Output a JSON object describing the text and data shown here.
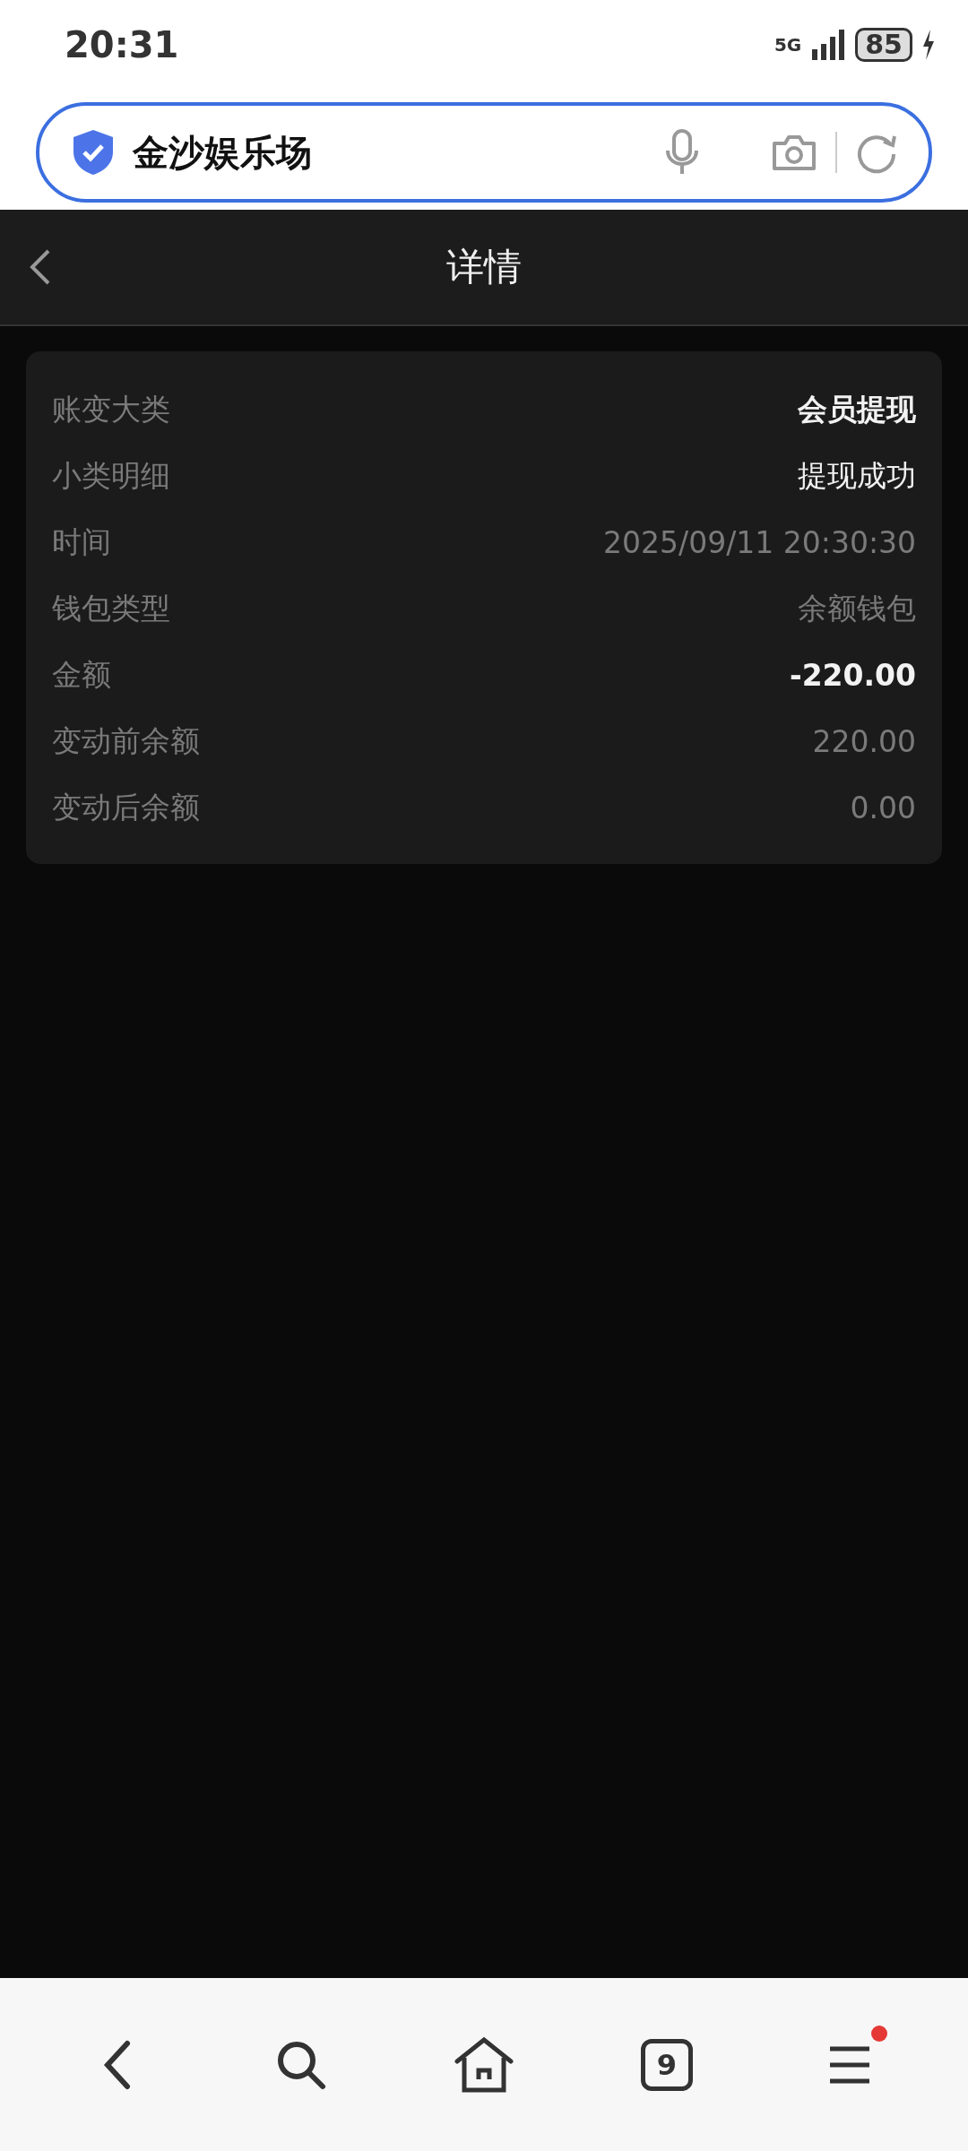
{
  "status_bar": {
    "time": "20:31",
    "network": "5G",
    "battery": "85"
  },
  "address_bar": {
    "value": "金沙娱乐场"
  },
  "header": {
    "title": "详情"
  },
  "details": [
    {
      "label": "账变大类",
      "value": "会员提现",
      "kind": "bold"
    },
    {
      "label": "小类明细",
      "value": "提现成功",
      "kind": "plain"
    },
    {
      "label": "时间",
      "value": "2025/09/11 20:30:30",
      "kind": "muted"
    },
    {
      "label": "钱包类型",
      "value": "余额钱包",
      "kind": "muted"
    },
    {
      "label": "金额",
      "value": "-220.00",
      "kind": "bold"
    },
    {
      "label": "变动前余额",
      "value": "220.00",
      "kind": "muted"
    },
    {
      "label": "变动后余额",
      "value": "0.00",
      "kind": "muted"
    }
  ],
  "bottom_nav": {
    "tab_count": "9",
    "menu_badge": true
  }
}
